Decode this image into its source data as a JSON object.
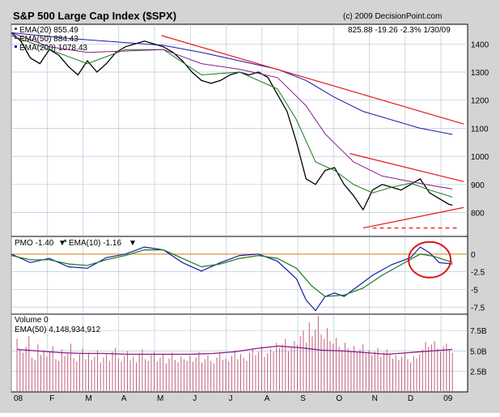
{
  "header": {
    "title": "S&P 500 Large Cap Index ($SPX)",
    "copyright": "(c) 2009 DecisionPoint.com",
    "quote": "825.88  -19.26  -2.3%  1/30/09"
  },
  "price_legend": [
    {
      "label": "EMA(20) 855.49",
      "color": "#1a7a1a"
    },
    {
      "label": "EMA(50) 884.43",
      "color": "#8b1a8b"
    },
    {
      "label": "EMA(200) 1078.43",
      "color": "#1a1aa8"
    }
  ],
  "pmo_legend": {
    "pmo_label": "PMO  -1.40",
    "pmo_color": "#1a1aa8",
    "ema_label": "EMA(10)  -1.16",
    "ema_color": "#1a7a1a",
    "down_arrow": "▼"
  },
  "volume_legend": {
    "volume_label": "Volume  0",
    "ema_label": "EMA(50)  4,148,934,912",
    "ema_color": "#8b1a8b"
  },
  "x_axis": {
    "labels": [
      "08",
      "F",
      "M",
      "A",
      "M",
      "J",
      "J",
      "A",
      "S",
      "O",
      "N",
      "D",
      "09"
    ]
  },
  "chart_data": [
    {
      "type": "line",
      "panel": "price",
      "yticks": [
        800,
        900,
        1000,
        1100,
        1200,
        1300,
        1400
      ],
      "ylim": [
        715,
        1470
      ],
      "series": [
        {
          "name": "$SPX",
          "color": "#000000",
          "points": [
            [
              0,
              1440
            ],
            [
              5,
              1410
            ],
            [
              10,
              1350
            ],
            [
              15,
              1330
            ],
            [
              20,
              1380
            ],
            [
              25,
              1360
            ],
            [
              30,
              1320
            ],
            [
              35,
              1290
            ],
            [
              40,
              1340
            ],
            [
              45,
              1300
            ],
            [
              50,
              1330
            ],
            [
              55,
              1370
            ],
            [
              60,
              1390
            ],
            [
              65,
              1400
            ],
            [
              70,
              1410
            ],
            [
              75,
              1400
            ],
            [
              80,
              1390
            ],
            [
              85,
              1370
            ],
            [
              90,
              1340
            ],
            [
              95,
              1300
            ],
            [
              100,
              1270
            ],
            [
              105,
              1260
            ],
            [
              110,
              1270
            ],
            [
              115,
              1290
            ],
            [
              120,
              1300
            ],
            [
              125,
              1290
            ],
            [
              130,
              1300
            ],
            [
              135,
              1280
            ],
            [
              140,
              1220
            ],
            [
              145,
              1160
            ],
            [
              150,
              1050
            ],
            [
              155,
              920
            ],
            [
              160,
              900
            ],
            [
              165,
              950
            ],
            [
              170,
              960
            ],
            [
              175,
              900
            ],
            [
              180,
              860
            ],
            [
              185,
              810
            ],
            [
              190,
              880
            ],
            [
              195,
              900
            ],
            [
              200,
              890
            ],
            [
              205,
              880
            ],
            [
              210,
              900
            ],
            [
              215,
              920
            ],
            [
              220,
              870
            ],
            [
              225,
              850
            ],
            [
              230,
              830
            ],
            [
              232,
              826
            ]
          ]
        },
        {
          "name": "EMA(20)",
          "color": "#1a7a1a",
          "points": [
            [
              0,
              1430
            ],
            [
              20,
              1380
            ],
            [
              40,
              1330
            ],
            [
              60,
              1380
            ],
            [
              80,
              1380
            ],
            [
              100,
              1290
            ],
            [
              120,
              1300
            ],
            [
              140,
              1240
            ],
            [
              150,
              1130
            ],
            [
              160,
              980
            ],
            [
              170,
              950
            ],
            [
              180,
              900
            ],
            [
              190,
              870
            ],
            [
              200,
              890
            ],
            [
              210,
              905
            ],
            [
              220,
              880
            ],
            [
              232,
              855
            ]
          ]
        },
        {
          "name": "EMA(50)",
          "color": "#8b1a8b",
          "points": [
            [
              0,
              1440
            ],
            [
              20,
              1390
            ],
            [
              40,
              1370
            ],
            [
              60,
              1375
            ],
            [
              80,
              1380
            ],
            [
              100,
              1330
            ],
            [
              120,
              1310
            ],
            [
              140,
              1280
            ],
            [
              155,
              1180
            ],
            [
              165,
              1080
            ],
            [
              180,
              980
            ],
            [
              195,
              930
            ],
            [
              210,
              910
            ],
            [
              222,
              895
            ],
            [
              232,
              884
            ]
          ]
        },
        {
          "name": "EMA(200)",
          "color": "#1a1aa8",
          "points": [
            [
              0,
              1440
            ],
            [
              30,
              1420
            ],
            [
              60,
              1405
            ],
            [
              80,
              1395
            ],
            [
              100,
              1370
            ],
            [
              120,
              1340
            ],
            [
              140,
              1310
            ],
            [
              155,
              1270
            ],
            [
              170,
              1210
            ],
            [
              185,
              1160
            ],
            [
              200,
              1130
            ],
            [
              215,
              1100
            ],
            [
              232,
              1078
            ]
          ]
        }
      ],
      "trendlines": [
        {
          "color": "#e31a1a",
          "points": [
            [
              79,
              1430
            ],
            [
              238,
              1115
            ]
          ]
        },
        {
          "color": "#e31a1a",
          "points": [
            [
              178,
              1010
            ],
            [
              238,
              910
            ]
          ]
        },
        {
          "color": "#e31a1a",
          "points": [
            [
              185,
              745
            ],
            [
              238,
              818
            ]
          ]
        },
        {
          "color": "#e31a1a",
          "dashed": true,
          "points": [
            [
              190,
              745
            ],
            [
              235,
              745
            ]
          ]
        }
      ]
    },
    {
      "type": "line",
      "panel": "pmo",
      "yticks": [
        -7.5,
        -5,
        -2.5,
        0
      ],
      "ylim": [
        -8.5,
        2.5
      ],
      "zero_color": "#d98c2a",
      "series": [
        {
          "name": "PMO",
          "color": "#1a1aa8",
          "points": [
            [
              0,
              0
            ],
            [
              10,
              -1.2
            ],
            [
              20,
              -0.6
            ],
            [
              30,
              -1.8
            ],
            [
              40,
              -2
            ],
            [
              50,
              -0.5
            ],
            [
              60,
              0
            ],
            [
              70,
              1.0
            ],
            [
              80,
              0.6
            ],
            [
              90,
              -1.2
            ],
            [
              100,
              -2.4
            ],
            [
              110,
              -1.2
            ],
            [
              120,
              -0.2
            ],
            [
              130,
              0
            ],
            [
              140,
              -1
            ],
            [
              150,
              -3.5
            ],
            [
              155,
              -6.5
            ],
            [
              160,
              -8
            ],
            [
              165,
              -6
            ],
            [
              170,
              -5.5
            ],
            [
              175,
              -6
            ],
            [
              180,
              -5
            ],
            [
              190,
              -3
            ],
            [
              200,
              -1.5
            ],
            [
              210,
              -0.5
            ],
            [
              215,
              1.0
            ],
            [
              220,
              0.2
            ],
            [
              225,
              -1.2
            ],
            [
              232,
              -1.4
            ]
          ]
        },
        {
          "name": "EMA(10)",
          "color": "#1a7a1a",
          "points": [
            [
              0,
              -0.2
            ],
            [
              10,
              -0.8
            ],
            [
              20,
              -0.8
            ],
            [
              30,
              -1.4
            ],
            [
              40,
              -1.6
            ],
            [
              50,
              -0.8
            ],
            [
              60,
              -0.2
            ],
            [
              70,
              0.6
            ],
            [
              80,
              0.6
            ],
            [
              90,
              -0.6
            ],
            [
              100,
              -1.8
            ],
            [
              110,
              -1.4
            ],
            [
              120,
              -0.6
            ],
            [
              130,
              -0.2
            ],
            [
              140,
              -0.6
            ],
            [
              150,
              -2
            ],
            [
              158,
              -4.5
            ],
            [
              165,
              -6
            ],
            [
              175,
              -5.8
            ],
            [
              185,
              -4.8
            ],
            [
              195,
              -3
            ],
            [
              205,
              -1.5
            ],
            [
              215,
              0
            ],
            [
              222,
              -0.3
            ],
            [
              232,
              -1.16
            ]
          ]
        }
      ],
      "annotation": {
        "shape": "ellipse",
        "color": "#d81a1a",
        "center": [
          220,
          -0.8
        ]
      }
    },
    {
      "type": "bar",
      "panel": "volume",
      "yticks": [
        "2.5B",
        "5.0B",
        "7.5B"
      ],
      "ylim": [
        0,
        9.5
      ],
      "bar_color": "#c06080",
      "ema_color": "#8b1a8b",
      "values": [
        6.5,
        5.2,
        4.8,
        5.5,
        6.8,
        4.2,
        3.9,
        5.8,
        4.5,
        5.1,
        4.3,
        4.9,
        5.6,
        4.0,
        3.8,
        5.2,
        4.4,
        4.7,
        5.9,
        4.1,
        3.7,
        4.6,
        5.3,
        4.0,
        4.8,
        3.9,
        4.3,
        5.1,
        3.6,
        4.2,
        4.6,
        3.8,
        4.9,
        5.4,
        4.1,
        3.7,
        4.4,
        5.0,
        3.9,
        4.3,
        3.6,
        4.7,
        5.2,
        4.0,
        3.8,
        4.5,
        4.9,
        3.7,
        4.2,
        4.6,
        3.5,
        4.1,
        4.8,
        3.9,
        3.6,
        4.3,
        4.0,
        3.8,
        4.4,
        3.7,
        4.2,
        4.9,
        3.6,
        4.0,
        4.5,
        3.8,
        3.5,
        4.2,
        4.7,
        3.9,
        4.1,
        3.7,
        4.4,
        5.1,
        4.0,
        4.6,
        4.2,
        3.8,
        4.8,
        5.3,
        4.5,
        4.9,
        5.6,
        4.3,
        4.7,
        5.2,
        4.9,
        6.0,
        5.4,
        5.8,
        6.5,
        5.0,
        5.5,
        6.2,
        5.7,
        6.8,
        7.5,
        6.0,
        8.5,
        6.8,
        7.6,
        9.3,
        7.0,
        6.5,
        7.8,
        6.2,
        5.9,
        6.6,
        5.5,
        5.1,
        6.0,
        5.3,
        4.9,
        5.6,
        4.8,
        5.2,
        5.8,
        4.7,
        5.1,
        4.5,
        4.9,
        5.4,
        4.3,
        4.8,
        5.2,
        4.6,
        4.1,
        4.5,
        3.9,
        4.3,
        4.8,
        4.0,
        3.6,
        4.4,
        4.1,
        4.6,
        5.2,
        6.1,
        5.5,
        5.8,
        6.2,
        5.3,
        4.9,
        5.6,
        5.9,
        5.2,
        4.8
      ],
      "ema": [
        5.2,
        5.0,
        4.8,
        4.7,
        4.7,
        4.6,
        4.6,
        4.6,
        4.6,
        4.7,
        4.9,
        5.3,
        5.6,
        5.4,
        5.1,
        5.0,
        4.8,
        4.6,
        4.8,
        5.0,
        5.2
      ]
    }
  ]
}
